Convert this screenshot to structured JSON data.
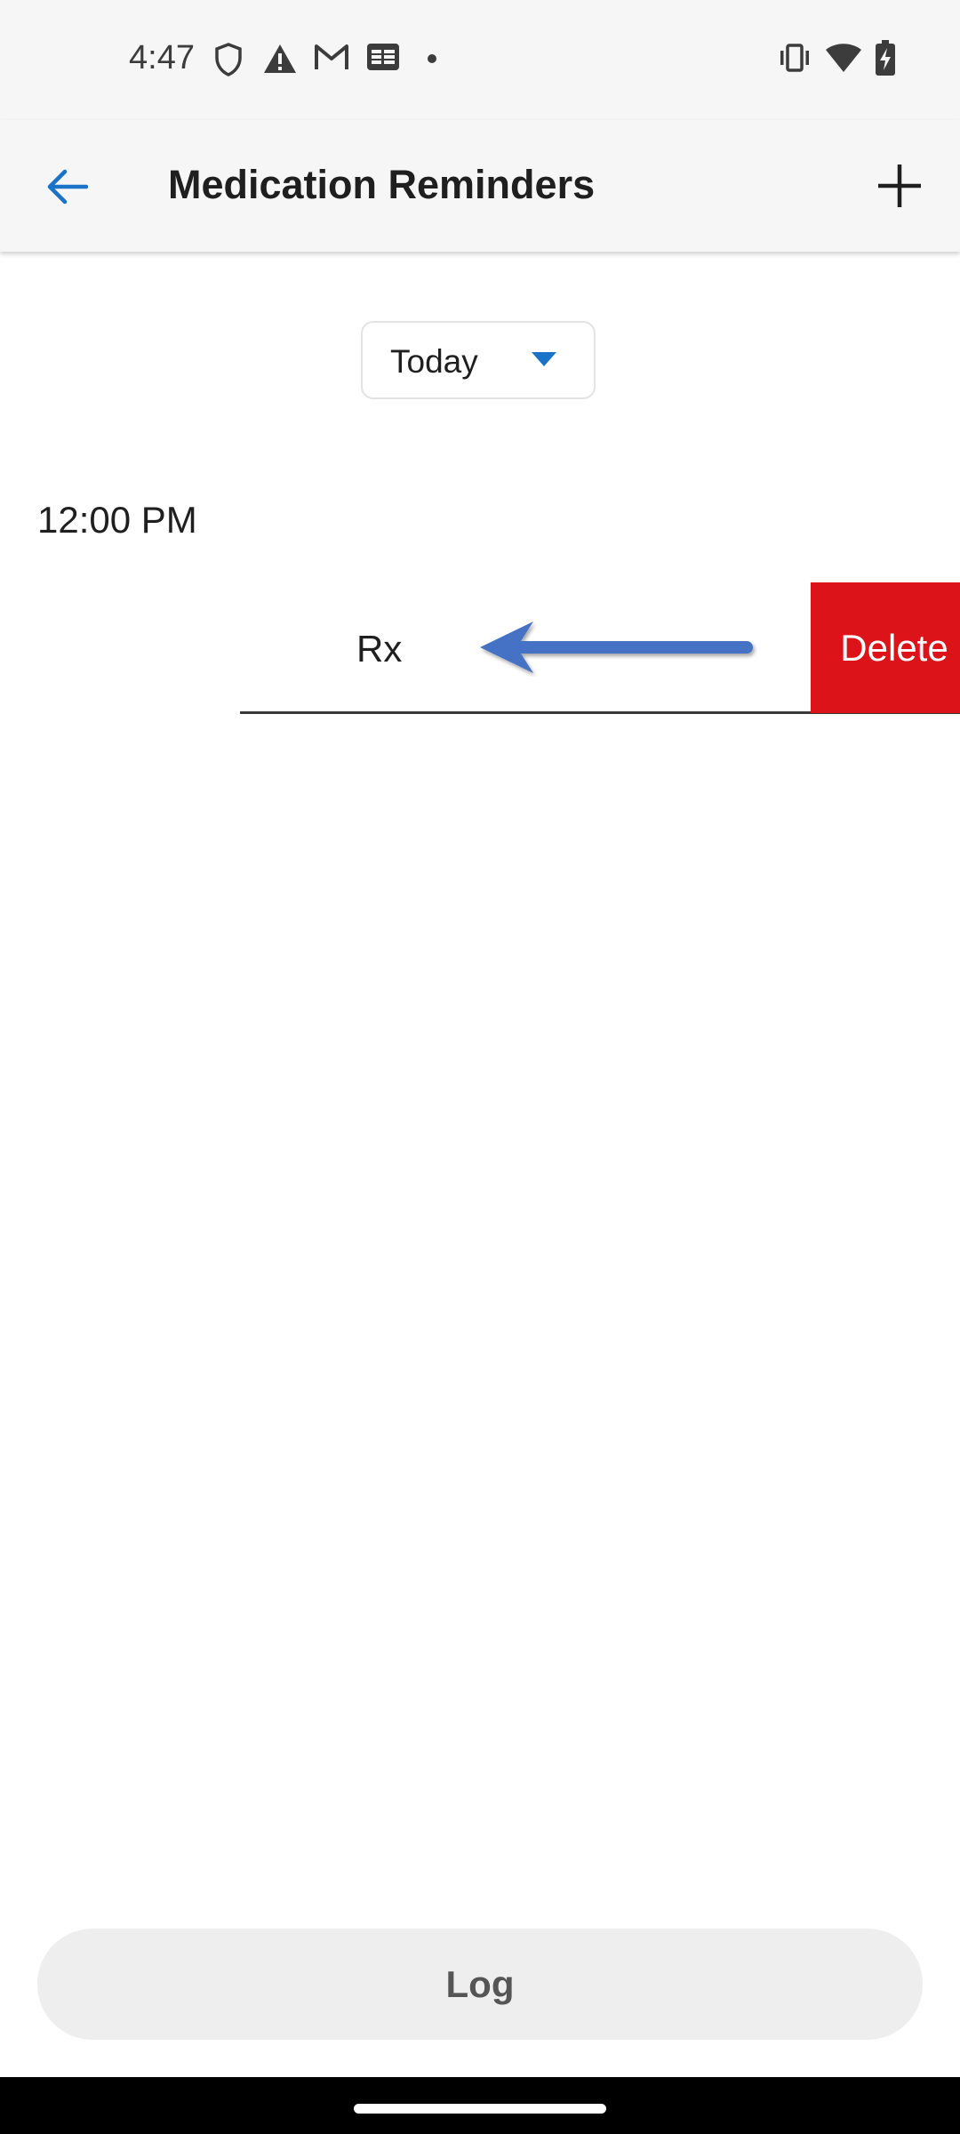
{
  "status_bar": {
    "time": "4:47",
    "left_icons": [
      "shield-icon",
      "alert-icon",
      "gmail-icon",
      "news-icon",
      "dot-icon"
    ],
    "right_icons": [
      "vibrate-icon",
      "wifi-icon",
      "battery-charging-icon"
    ]
  },
  "app_bar": {
    "title": "Medication Reminders",
    "back_icon": "arrow-back-icon",
    "add_icon": "plus-icon"
  },
  "date_filter": {
    "selected": "Today"
  },
  "reminders": [
    {
      "time": "12:00 PM",
      "items": [
        {
          "name": "Rx",
          "action_label": "Delete"
        }
      ]
    }
  ],
  "footer": {
    "log_label": "Log"
  },
  "colors": {
    "accent": "#1a73c8",
    "delete": "#dc141a",
    "swipe_arrow": "#4472c4",
    "app_bar_bg": "#f6f6f6",
    "log_button_bg": "#eeeeee"
  }
}
